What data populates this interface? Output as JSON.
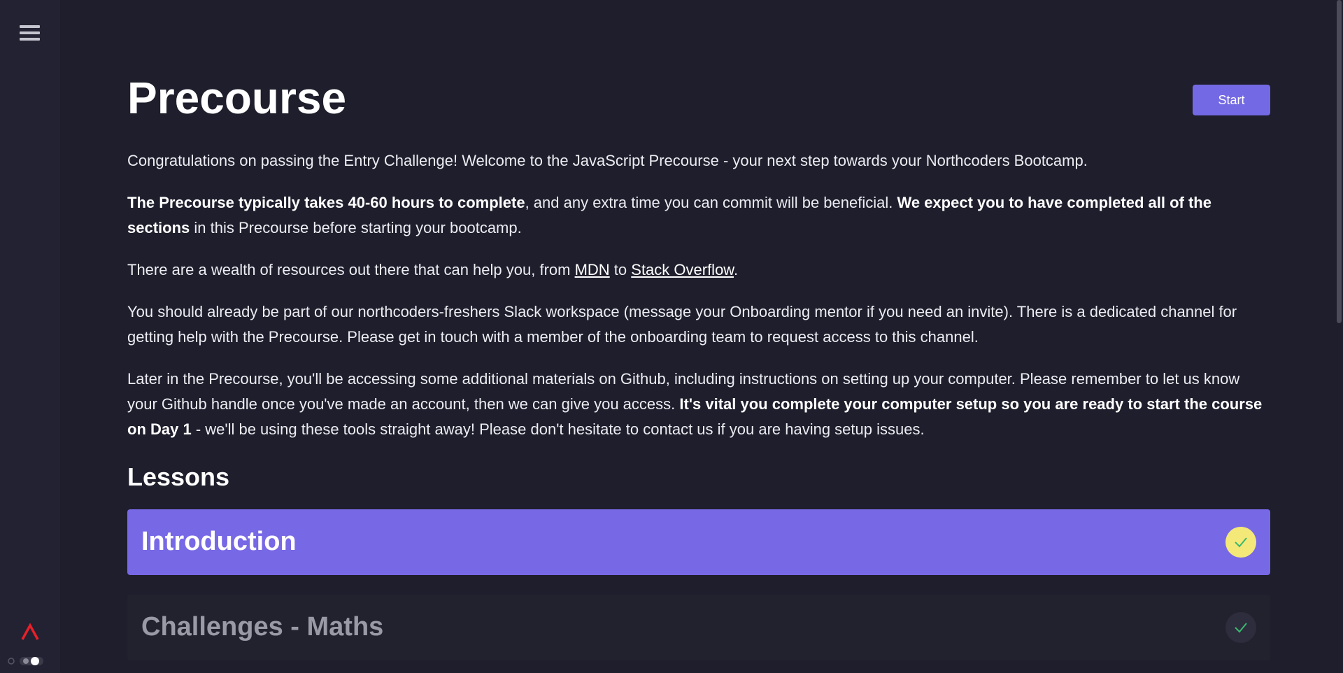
{
  "sidebar": {
    "menu_icon": "hamburger-menu-icon",
    "logo_icon": "northcoders-logo-icon",
    "theme_toggle_icon": "theme-toggle-icon"
  },
  "page": {
    "title": "Precourse",
    "start_label": "Start"
  },
  "intro": {
    "p1": "Congratulations on passing the Entry Challenge! Welcome to the JavaScript Precourse - your next step towards your Northcoders Bootcamp.",
    "p2_bold1": "The Precourse typically takes 40-60 hours to complete",
    "p2_text1": ", and any extra time you can commit will be beneficial. ",
    "p2_bold2": "We expect you to have completed all of the sections",
    "p2_text2": " in this Precourse before starting your bootcamp.",
    "p3_text1": "There are a wealth of resources out there that can help you, from ",
    "p3_link1": "MDN",
    "p3_text2": " to ",
    "p3_link2": "Stack Overflow",
    "p3_text3": ".",
    "p4": "You should already be part of our northcoders-freshers Slack workspace (message your Onboarding mentor if you need an invite). There is a dedicated channel for getting help with the Precourse. Please get in touch with a member of the onboarding team to request access to this channel.",
    "p5_text1": "Later in the Precourse, you'll be accessing some additional materials on Github, including instructions on setting up your computer. Please remember to let us know your Github handle once you've made an account, then we can give you access. ",
    "p5_bold": "It's vital you complete your computer setup so you are ready to start the course on Day 1",
    "p5_text2": " - we'll be using these tools straight away! Please don't hesitate to contact us if you are having setup issues."
  },
  "lessons": {
    "heading": "Lessons",
    "items": [
      {
        "title": "Introduction",
        "status_icon": "check-icon",
        "status_color": "#f4e978"
      },
      {
        "title": "Challenges - Maths",
        "status_icon": "check-icon",
        "status_color": "#2d2d3d"
      }
    ]
  },
  "colors": {
    "background": "#1e1e2c",
    "sidebar": "#222232",
    "accent": "#7469e4",
    "check_active": "#f4e978",
    "check_mark": "#3bb86f",
    "logo": "#e8202a"
  }
}
